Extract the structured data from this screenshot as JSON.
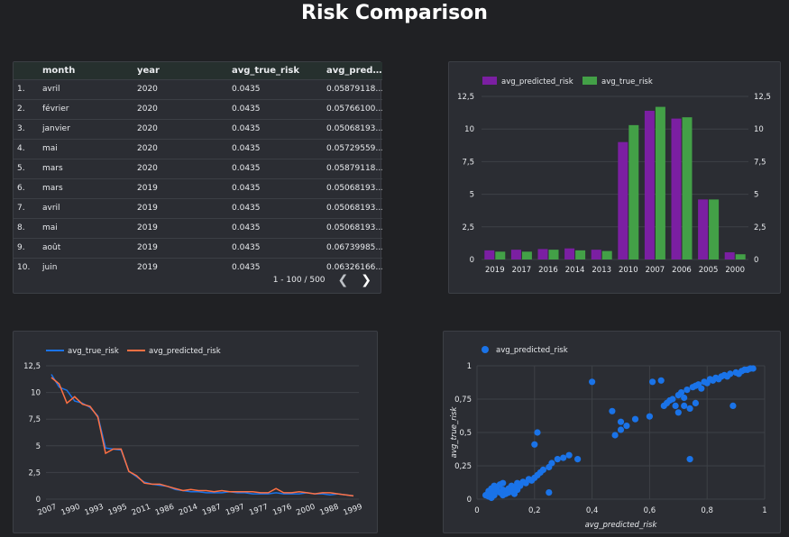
{
  "title": "Risk Comparison",
  "table": {
    "columns": [
      "",
      "month",
      "year",
      "avg_true_risk",
      "avg_pred…"
    ],
    "rows": [
      [
        "1.",
        "avril",
        "2020",
        "0.0435",
        "0.05879118…"
      ],
      [
        "2.",
        "février",
        "2020",
        "0.0435",
        "0.05766100…"
      ],
      [
        "3.",
        "janvier",
        "2020",
        "0.0435",
        "0.05068193…"
      ],
      [
        "4.",
        "mai",
        "2020",
        "0.0435",
        "0.05729559…"
      ],
      [
        "5.",
        "mars",
        "2020",
        "0.0435",
        "0.05879118…"
      ],
      [
        "6.",
        "mars",
        "2019",
        "0.0435",
        "0.05068193…"
      ],
      [
        "7.",
        "avril",
        "2019",
        "0.0435",
        "0.05068193…"
      ],
      [
        "8.",
        "mai",
        "2019",
        "0.0435",
        "0.05068193…"
      ],
      [
        "9.",
        "août",
        "2019",
        "0.0435",
        "0.06739985…"
      ],
      [
        "10.",
        "juin",
        "2019",
        "0.0435",
        "0.06326166…"
      ]
    ],
    "pagination": "1 - 100 / 500",
    "prev_icon": "chevron-left-icon",
    "next_icon": "chevron-right-icon"
  },
  "colors": {
    "purple": "#7b1fa2",
    "green": "#43a047",
    "blue": "#1a73e8",
    "orange": "#ff7043",
    "scatter": "#1a73e8"
  },
  "chart_data": [
    {
      "type": "bar",
      "categories": [
        "2019",
        "2017",
        "2016",
        "2014",
        "2013",
        "2010",
        "2007",
        "2006",
        "2005",
        "2000"
      ],
      "series": [
        {
          "name": "avg_predicted_risk",
          "values": [
            0.7,
            0.75,
            0.8,
            0.85,
            0.75,
            9.0,
            11.4,
            10.8,
            4.6,
            0.55
          ]
        },
        {
          "name": "avg_true_risk",
          "values": [
            0.6,
            0.6,
            0.75,
            0.7,
            0.65,
            10.3,
            11.7,
            10.9,
            4.6,
            0.4
          ]
        }
      ],
      "yticks": [
        "0",
        "2,5",
        "5",
        "7,5",
        "10",
        "12,5"
      ],
      "ylim": [
        0,
        12.5
      ],
      "legend": "top-left"
    },
    {
      "type": "line",
      "xticks": [
        "2007",
        "1990",
        "1993",
        "1995",
        "2011",
        "1986",
        "2014",
        "1987",
        "1997",
        "1977",
        "1976",
        "2000",
        "1988",
        "1999"
      ],
      "series": [
        {
          "name": "avg_true_risk",
          "values": [
            11.7,
            10.5,
            10.2,
            9.2,
            9.0,
            8.6,
            7.8,
            4.8,
            4.7,
            4.6,
            2.6,
            2.1,
            1.6,
            1.4,
            1.3,
            1.2,
            0.9,
            0.8,
            0.7,
            0.7,
            0.6,
            0.6,
            0.6,
            0.7,
            0.6,
            0.6,
            0.5,
            0.5,
            0.5,
            0.6,
            0.5,
            0.5,
            0.5,
            0.6,
            0.5,
            0.5,
            0.4,
            0.5,
            0.4,
            0.3
          ]
        },
        {
          "name": "avg_predicted_risk",
          "values": [
            11.4,
            10.8,
            9.0,
            9.6,
            8.9,
            8.7,
            7.7,
            4.3,
            4.7,
            4.7,
            2.6,
            2.2,
            1.5,
            1.4,
            1.4,
            1.2,
            1.0,
            0.8,
            0.9,
            0.8,
            0.8,
            0.7,
            0.8,
            0.7,
            0.7,
            0.7,
            0.7,
            0.6,
            0.6,
            1.0,
            0.6,
            0.6,
            0.7,
            0.6,
            0.5,
            0.6,
            0.6,
            0.5,
            0.4,
            0.3
          ]
        }
      ],
      "yticks": [
        "0",
        "2,5",
        "5",
        "7,5",
        "10",
        "12,5"
      ],
      "ylim": [
        0,
        12.5
      ],
      "legend": "top-left"
    },
    {
      "type": "scatter",
      "series": [
        {
          "name": "avg_predicted_risk"
        }
      ],
      "points": [
        [
          0.04,
          0.02
        ],
        [
          0.05,
          0.04
        ],
        [
          0.06,
          0.05
        ],
        [
          0.07,
          0.06
        ],
        [
          0.08,
          0.05
        ],
        [
          0.05,
          0.01
        ],
        [
          0.06,
          0.03
        ],
        [
          0.09,
          0.07
        ],
        [
          0.1,
          0.06
        ],
        [
          0.11,
          0.08
        ],
        [
          0.12,
          0.1
        ],
        [
          0.13,
          0.09
        ],
        [
          0.14,
          0.12
        ],
        [
          0.15,
          0.1
        ],
        [
          0.16,
          0.13
        ],
        [
          0.17,
          0.12
        ],
        [
          0.18,
          0.15
        ],
        [
          0.19,
          0.14
        ],
        [
          0.2,
          0.16
        ],
        [
          0.21,
          0.18
        ],
        [
          0.22,
          0.2
        ],
        [
          0.23,
          0.22
        ],
        [
          0.25,
          0.24
        ],
        [
          0.26,
          0.27
        ],
        [
          0.28,
          0.3
        ],
        [
          0.3,
          0.31
        ],
        [
          0.32,
          0.33
        ],
        [
          0.35,
          0.3
        ],
        [
          0.2,
          0.41
        ],
        [
          0.21,
          0.5
        ],
        [
          0.25,
          0.05
        ],
        [
          0.4,
          0.88
        ],
        [
          0.48,
          0.48
        ],
        [
          0.5,
          0.52
        ],
        [
          0.52,
          0.55
        ],
        [
          0.55,
          0.6
        ],
        [
          0.6,
          0.62
        ],
        [
          0.61,
          0.88
        ],
        [
          0.64,
          0.89
        ],
        [
          0.65,
          0.7
        ],
        [
          0.66,
          0.72
        ],
        [
          0.67,
          0.74
        ],
        [
          0.68,
          0.75
        ],
        [
          0.69,
          0.7
        ],
        [
          0.7,
          0.78
        ],
        [
          0.71,
          0.8
        ],
        [
          0.72,
          0.76
        ],
        [
          0.73,
          0.82
        ],
        [
          0.74,
          0.3
        ],
        [
          0.75,
          0.84
        ],
        [
          0.76,
          0.85
        ],
        [
          0.77,
          0.86
        ],
        [
          0.78,
          0.83
        ],
        [
          0.79,
          0.88
        ],
        [
          0.8,
          0.87
        ],
        [
          0.81,
          0.9
        ],
        [
          0.82,
          0.89
        ],
        [
          0.83,
          0.91
        ],
        [
          0.84,
          0.9
        ],
        [
          0.85,
          0.92
        ],
        [
          0.86,
          0.93
        ],
        [
          0.87,
          0.92
        ],
        [
          0.88,
          0.94
        ],
        [
          0.89,
          0.7
        ],
        [
          0.9,
          0.95
        ],
        [
          0.91,
          0.94
        ],
        [
          0.92,
          0.96
        ],
        [
          0.93,
          0.97
        ],
        [
          0.94,
          0.97
        ],
        [
          0.95,
          0.98
        ],
        [
          0.96,
          0.98
        ],
        [
          0.7,
          0.65
        ],
        [
          0.72,
          0.7
        ],
        [
          0.74,
          0.68
        ],
        [
          0.76,
          0.72
        ],
        [
          0.47,
          0.66
        ],
        [
          0.5,
          0.58
        ],
        [
          0.09,
          0.03
        ],
        [
          0.1,
          0.04
        ],
        [
          0.11,
          0.05
        ],
        [
          0.12,
          0.06
        ],
        [
          0.13,
          0.04
        ],
        [
          0.14,
          0.07
        ],
        [
          0.03,
          0.03
        ],
        [
          0.04,
          0.06
        ],
        [
          0.05,
          0.08
        ],
        [
          0.06,
          0.1
        ],
        [
          0.07,
          0.09
        ],
        [
          0.08,
          0.11
        ],
        [
          0.09,
          0.12
        ]
      ],
      "xticks": [
        "0",
        "0,2",
        "0,4",
        "0,6",
        "0,8",
        "1"
      ],
      "yticks": [
        "0",
        "0,25",
        "0,5",
        "0,75",
        "1"
      ],
      "xlim": [
        0,
        1
      ],
      "ylim": [
        0,
        1
      ],
      "xlabel": "avg_predicted_risk",
      "ylabel": "avg_true_risk",
      "legend": "top-left"
    }
  ]
}
